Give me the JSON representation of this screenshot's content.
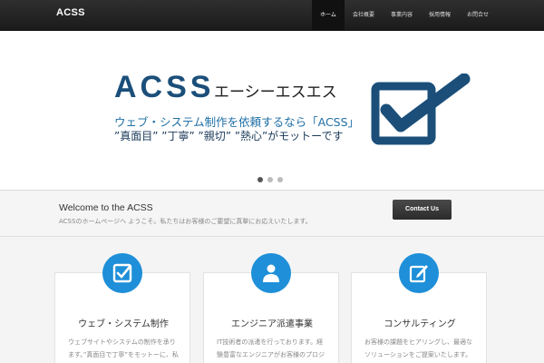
{
  "navbar": {
    "brand": "ACSS",
    "items": [
      {
        "label": "ホーム",
        "active": true
      },
      {
        "label": "会社概要",
        "active": false
      },
      {
        "label": "事業内容",
        "active": false
      },
      {
        "label": "採用情報",
        "active": false
      },
      {
        "label": "お問合せ",
        "active": false
      }
    ]
  },
  "hero": {
    "logo": "ACSS",
    "kana": "エーシーエスエス",
    "line1": "ウェブ・システム制作を依頼するなら「ACSS」",
    "line2": "”真面目” ”丁寧” ”親切” ”熱心”がモットーです",
    "check_icon": "check-mark-icon",
    "slides": 3,
    "active_slide": 1
  },
  "welcome": {
    "title": "Welcome to the ACSS",
    "subtitle": "ACSSのホームページへ ようこそ。私たちはお客様のご要望に真摯にお応えいたします。",
    "button": "Contact Us"
  },
  "features": [
    {
      "icon": "check-icon",
      "title": "ウェブ・システム制作",
      "text": "ウェブサイトやシステムの制作を承ります。”真面目で丁寧”をモットーに、私たちACSSが全力でサポートいたします。"
    },
    {
      "icon": "person-icon",
      "title": "エンジニア派遣事業",
      "text": "IT技術者の派遣を行っております。経験豊富なエンジニアがお客様のプロジェクトを”熱心”に支えます。"
    },
    {
      "icon": "edit-icon",
      "title": "コンサルティング",
      "text": "お客様の課題をヒアリングし、最適なソリューションをご提案いたします。お気軽にご相談ください。"
    }
  ],
  "colors": {
    "navbar": "#222222",
    "accent": "#1e8fd8",
    "logo": "#1b4f7a"
  }
}
